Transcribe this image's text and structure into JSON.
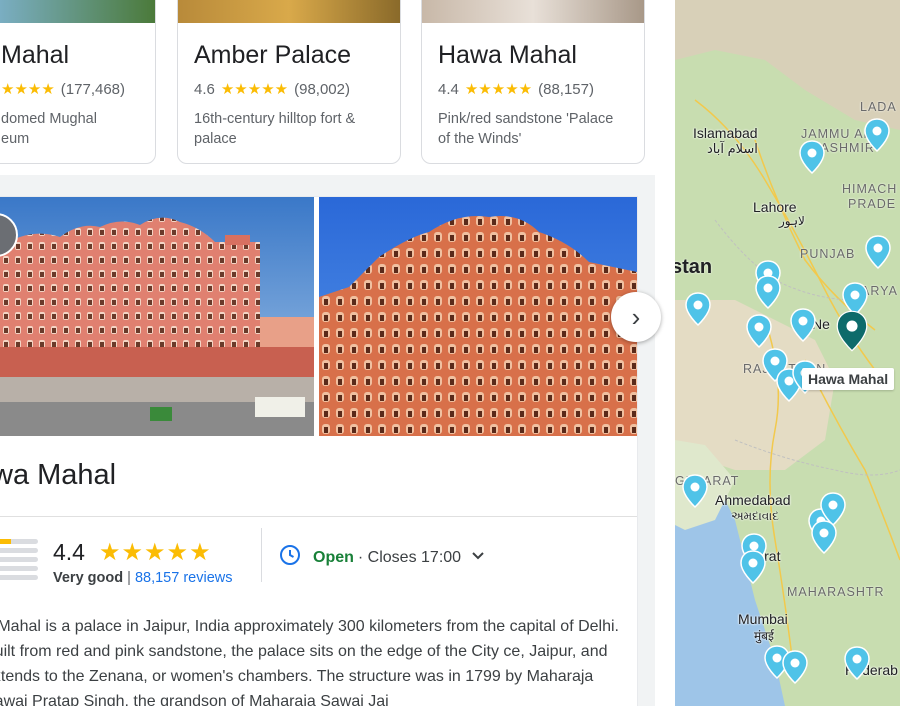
{
  "cards": [
    {
      "title": "Mahal",
      "rating": "★★★★",
      "review_count": "(177,468)",
      "desc_line1": "domed Mughal",
      "desc_line2": "eum"
    },
    {
      "title": "Amber Palace",
      "score": "4.6",
      "rating": "★★★★★",
      "review_count": "(98,002)",
      "desc_line1": "16th-century hilltop fort &",
      "desc_line2": "palace"
    },
    {
      "title": "Hawa Mahal",
      "score": "4.4",
      "rating": "★★★★★",
      "review_count": "(88,157)",
      "desc_line1": "Pink/red sandstone 'Palace",
      "desc_line2": "of the Winds'"
    }
  ],
  "place": {
    "title": "wa Mahal",
    "score": "4.4",
    "stars": "★★★★★",
    "rating_word": "Very good",
    "separator": "|",
    "reviews_link": "88,157 reviews",
    "open_status": "Open",
    "closes": "· Closes 17:00",
    "description": "a Mahal is a palace in Jaipur, India approximately 300 kilometers from the capital of Delhi. Built from red and pink sandstone, the palace sits on the edge of the City ce, Jaipur, and extends to the Zenana, or women's chambers. The structure was in 1799 by Maharaja Sawai Pratap Singh, the grandson of Maharaja Sawai Jai"
  },
  "next_arrow": "›",
  "hours_chevron": "⌄",
  "map": {
    "cities": [
      {
        "name": "Islamabad"
      },
      {
        "name": "اسلام آباد"
      },
      {
        "name": "Lahore"
      },
      {
        "name": "لاہور"
      },
      {
        "name": "Ne"
      },
      {
        "name": "Ahmedabad"
      },
      {
        "name": "અમદાવાદ"
      },
      {
        "name": "Surat"
      },
      {
        "name": "Mumbai"
      },
      {
        "name": "मुंबई"
      },
      {
        "name": "Hyderab"
      }
    ],
    "states": [
      "LADA",
      "JAMMU AND",
      "KASHMIR",
      "HIMACH",
      "PRADE",
      "PUNJAB",
      "HARYA",
      "RAJASTHAN",
      "GUJARAT",
      "MAHARASHTR"
    ],
    "country": "stan",
    "tooltip": "Hawa Mahal"
  },
  "colors": {
    "accent_blue": "#1a73e8",
    "open_green": "#188038",
    "star_yellow": "#fbbc04",
    "pin_blue": "#4fc3e8",
    "pin_selected": "#0d6b6b"
  }
}
